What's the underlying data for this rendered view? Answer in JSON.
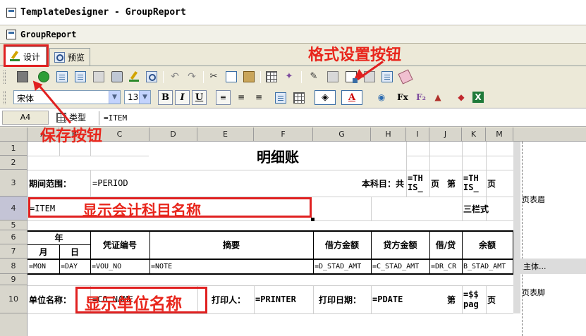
{
  "window": {
    "title": "TemplateDesigner - GroupReport",
    "doc_title": "GroupReport"
  },
  "tabs": {
    "design": "设计",
    "preview": "预览"
  },
  "font": {
    "family": "宋体",
    "size": "13"
  },
  "format_buttons": {
    "bold": "B",
    "italic": "I",
    "underline": "U"
  },
  "formula_bar": {
    "cell_ref": "A4",
    "type_label": "类型",
    "formula": "=ITEM"
  },
  "columns": [
    "A",
    "B",
    "C",
    "D",
    "E",
    "F",
    "G",
    "H",
    "I",
    "J",
    "K",
    "M"
  ],
  "rows": [
    "1",
    "2",
    "3",
    "4",
    "5",
    "6",
    "7",
    "8",
    "9",
    "10"
  ],
  "report": {
    "title": "明细账",
    "period_label": "期间范围：",
    "period_value": "=PERIOD",
    "subject_label": "本科目：共",
    "this1": "=TH IS_",
    "page_unit": "页",
    "page_no": "第",
    "this2": "=TH IS_",
    "page2": "页",
    "item": "=ITEM",
    "three_col": "三栏式",
    "hdr_year": "年",
    "hdr_month": "月",
    "hdr_day": "日",
    "hdr_voucher": "凭证编号",
    "hdr_summary": "摘要",
    "hdr_debit": "借方金额",
    "hdr_credit": "贷方金额",
    "hdr_dc": "借/贷",
    "hdr_balance": "余额",
    "r_mon": "=MON",
    "r_day": "=DAY",
    "r_vou": "=VOU_NO",
    "r_note": "=NOTE",
    "r_d": "=D_STAD_AMT",
    "r_c": "=C_STAD_AMT",
    "r_dr": "=DR_CR",
    "r_b": "B_STAD_AMT",
    "unit_label": "单位名称：",
    "unit_value": "=CO_NAME",
    "printer_label": "打印人：",
    "printer_value": "=PRINTER",
    "pdate_label": "打印日期：",
    "pdate_value": "=PDATE",
    "foot_no": "第",
    "foot_pag": "=$$ pag",
    "foot_page": "页"
  },
  "sections": {
    "header": "页表眉",
    "body": "主体...",
    "footer": "页表脚"
  },
  "annotations": {
    "format_btn": "格式设置按钮",
    "save_btn": "保存按钮",
    "show_subject": "显示会计科目名称",
    "show_unit": "显示单位名称"
  },
  "icons": {
    "save": "disk-icon",
    "format": "format-settings-icon",
    "bold": "bold-icon"
  },
  "accent": "#e02020"
}
